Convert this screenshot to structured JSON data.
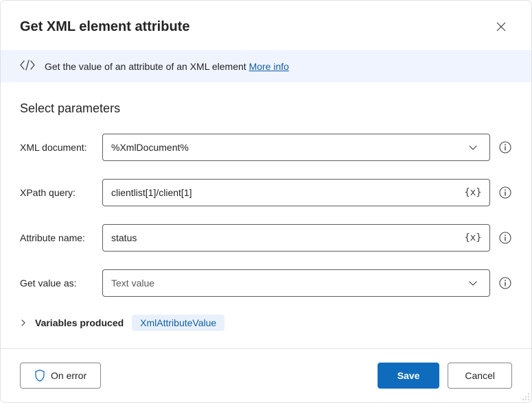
{
  "header": {
    "title": "Get XML element attribute"
  },
  "banner": {
    "text": "Get the value of an attribute of an XML element ",
    "link": "More info"
  },
  "section": {
    "title": "Select parameters"
  },
  "params": {
    "xml_document": {
      "label": "XML document:",
      "value": "%XmlDocument%"
    },
    "xpath_query": {
      "label": "XPath query:",
      "value": "clientlist[1]/client[1]"
    },
    "attribute_name": {
      "label": "Attribute name:",
      "value": "status"
    },
    "get_value_as": {
      "label": "Get value as:",
      "value": "Text value"
    }
  },
  "variables": {
    "label": "Variables produced",
    "badge": "XmlAttributeValue"
  },
  "footer": {
    "on_error": "On error",
    "save": "Save",
    "cancel": "Cancel"
  }
}
